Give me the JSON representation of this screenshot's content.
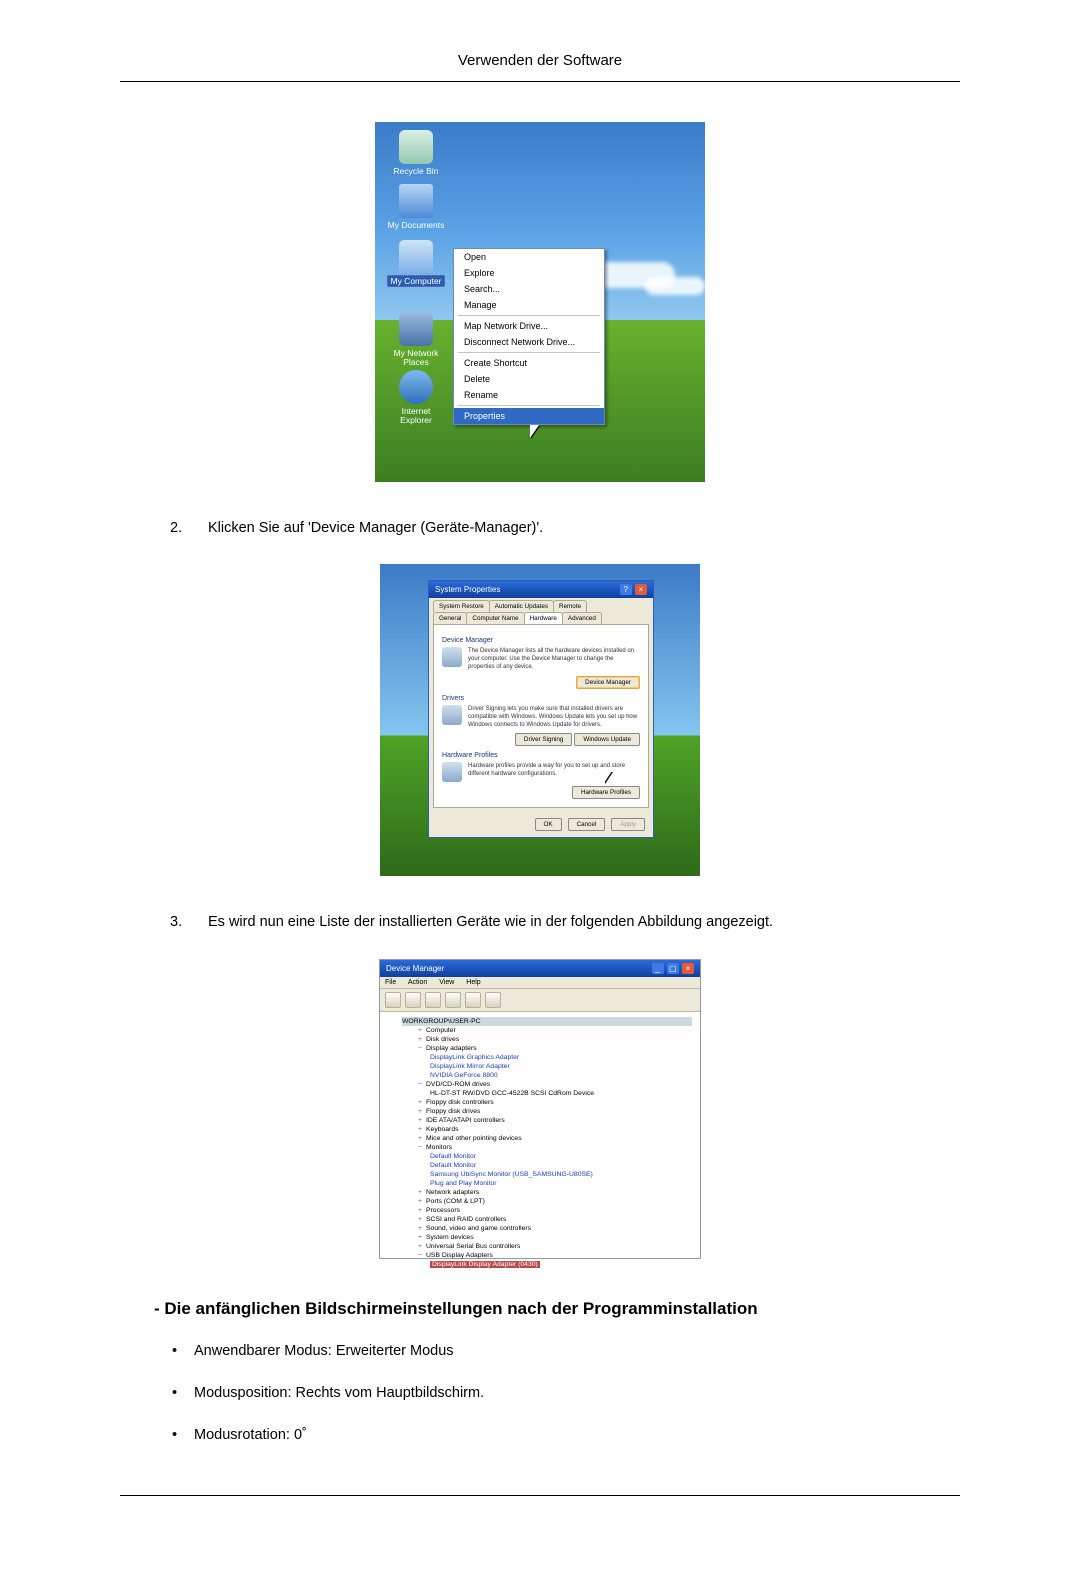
{
  "header": {
    "title": "Verwenden der Software"
  },
  "screenshot1": {
    "icons": {
      "recycle_bin": "Recycle Bin",
      "my_documents": "My Documents",
      "my_computer": "My Computer",
      "my_network_places": "My Network Places",
      "internet_explorer": "Internet Explorer"
    },
    "context_menu": {
      "open": "Open",
      "explore": "Explore",
      "search": "Search...",
      "manage": "Manage",
      "map_drive": "Map Network Drive...",
      "disconnect_drive": "Disconnect Network Drive...",
      "create_shortcut": "Create Shortcut",
      "delete": "Delete",
      "rename": "Rename",
      "properties": "Properties"
    }
  },
  "step2": {
    "num": "2.",
    "text": "Klicken Sie auf 'Device Manager (Geräte-Manager)'."
  },
  "screenshot2": {
    "dialog_title": "System Properties",
    "tabs": {
      "system_restore": "System Restore",
      "automatic_updates": "Automatic Updates",
      "remote": "Remote",
      "general": "General",
      "computer_name": "Computer Name",
      "hardware": "Hardware",
      "advanced": "Advanced"
    },
    "device_manager": {
      "title": "Device Manager",
      "desc": "The Device Manager lists all the hardware devices installed on your computer. Use the Device Manager to change the properties of any device.",
      "button": "Device Manager"
    },
    "drivers": {
      "title": "Drivers",
      "desc": "Driver Signing lets you make sure that installed drivers are compatible with Windows. Windows Update lets you set up how Windows connects to Windows Update for drivers.",
      "btn_signing": "Driver Signing",
      "btn_update": "Windows Update"
    },
    "hw_profiles": {
      "title": "Hardware Profiles",
      "desc": "Hardware profiles provide a way for you to set up and store different hardware configurations.",
      "button": "Hardware Profiles"
    },
    "footer": {
      "ok": "OK",
      "cancel": "Cancel",
      "apply": "Apply"
    }
  },
  "step3": {
    "num": "3.",
    "text": "Es wird nun eine Liste der installierten Geräte wie in der folgenden Abbildung angezeigt."
  },
  "screenshot3": {
    "title": "Device Manager",
    "menu": {
      "file": "File",
      "action": "Action",
      "view": "View",
      "help": "Help"
    },
    "tree": {
      "root": "WORKGROUP\\USER-PC",
      "computer": "Computer",
      "disk": "Disk drives",
      "display": "Display adapters",
      "display_children": [
        "DisplayLink Graphics Adapter",
        "DisplayLink Mirror Adapter",
        "NVIDIA GeForce 8800"
      ],
      "dvd": "DVD/CD-ROM drives",
      "dvd_child": "HL-DT-ST RW/DVD GCC-4522B SCSI CdRom Device",
      "floppy_ctrl": "Floppy disk controllers",
      "floppy": "Floppy disk drives",
      "ide": "IDE ATA/ATAPI controllers",
      "keyboards": "Keyboards",
      "mice": "Mice and other pointing devices",
      "monitors": "Monitors",
      "monitors_children": [
        "Default Monitor",
        "Default Monitor",
        "Samsung UbiSync Monitor (USB_SAMSUNG-U80SE)",
        "Plug and Play Monitor"
      ],
      "network": "Network adapters",
      "ports": "Ports (COM & LPT)",
      "processors": "Processors",
      "scsi": "SCSI and RAID controllers",
      "sound": "Sound, video and game controllers",
      "system": "System devices",
      "usb_ctrl": "Universal Serial Bus controllers",
      "usb_display": "USB Display Adapters",
      "usb_display_child": "DisplayLink Display Adapter (0430)"
    }
  },
  "section_heading": "- Die anfänglichen Bildschirmeinstellungen nach der Programminstallation",
  "bullets": {
    "b1": "Anwendbarer Modus: Erweiterter Modus",
    "b2": "Modusposition: Rechts vom Hauptbildschirm.",
    "b3": "Modusrotation: 0˚"
  }
}
